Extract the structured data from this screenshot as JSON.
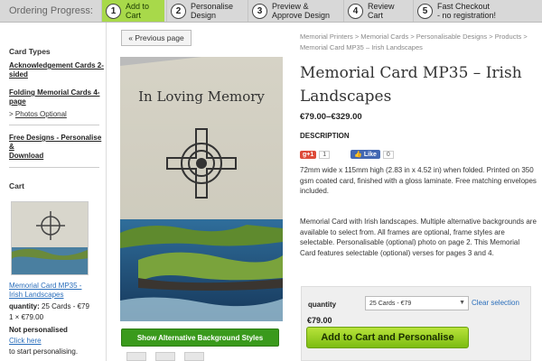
{
  "progress": {
    "label": "Ordering Progress:",
    "steps": [
      {
        "num": "1",
        "line1": "Add to",
        "line2": "Cart"
      },
      {
        "num": "2",
        "line1": "Personalise",
        "line2": "Design"
      },
      {
        "num": "3",
        "line1": "Preview &",
        "line2": "Approve Design"
      },
      {
        "num": "4",
        "line1": "Review",
        "line2": "Cart"
      },
      {
        "num": "5",
        "line1": "Fast Checkout",
        "line2": "- no registration!"
      }
    ],
    "active_color": "#a8d94a"
  },
  "sidebar": {
    "card_types_heading": "Card Types",
    "links": [
      {
        "line1": "Acknowledgement Cards 2-",
        "line2": "sided"
      },
      {
        "line1": "Folding Memorial Cards 4-",
        "line2": "page"
      }
    ],
    "sub_link": {
      "arrow": ">",
      "label": "Photos Optional"
    },
    "free_designs": {
      "line1": "Free Designs - Personalise &",
      "line2": "Download"
    },
    "cart_heading": "Cart",
    "cart_item": {
      "name_line1": "Memorial Card MP35 -",
      "name_line2": "Irish Landscapes",
      "quantity_label": "quantity:",
      "quantity_value": "25 Cards - €79",
      "line_total": "1 × €79.00",
      "status": "Not personalised",
      "click_link": "Click here",
      "click_suffix": "to start personalising."
    }
  },
  "content": {
    "prev_button": "« Previous page",
    "card_front_text": "In Loving Memory",
    "alt_bg_button": "Show Alternative Background Styles",
    "breadcrumb_line1": "Memorial Printers > Memorial Cards > Personalisable Designs > Products >",
    "breadcrumb_line2": "Memorial Card MP35 – Irish Landscapes",
    "title_line1": "Memorial Card MP35 – Irish",
    "title_line2": "Landscapes",
    "price_range": "€79.00–€329.00",
    "description_heading": "DESCRIPTION",
    "gplus_label": "g+1",
    "gplus_count": "1",
    "fb_label": "Like",
    "fb_count": "0",
    "desc_p1": "72mm wide x 115mm high (2.83 in x 4.52 in) when folded. Printed on 350 gsm coated card, finished with a gloss laminate. Free matching envelopes included.",
    "desc_p2": "Memorial Card with Irish landscapes. Multiple alternative backgrounds are available to select from. All frames are optional, frame styles are selectable. Personalisable (optional) photo on page 2.  This Memorial Card features selectable (optional) verses for pages 3 and 4.",
    "quantity_label": "quantity",
    "quantity_selected": "25 Cards - €79",
    "clear_selection": "Clear selection",
    "selected_price": "€79.00",
    "add_to_cart": "Add to Cart and Personalise"
  }
}
